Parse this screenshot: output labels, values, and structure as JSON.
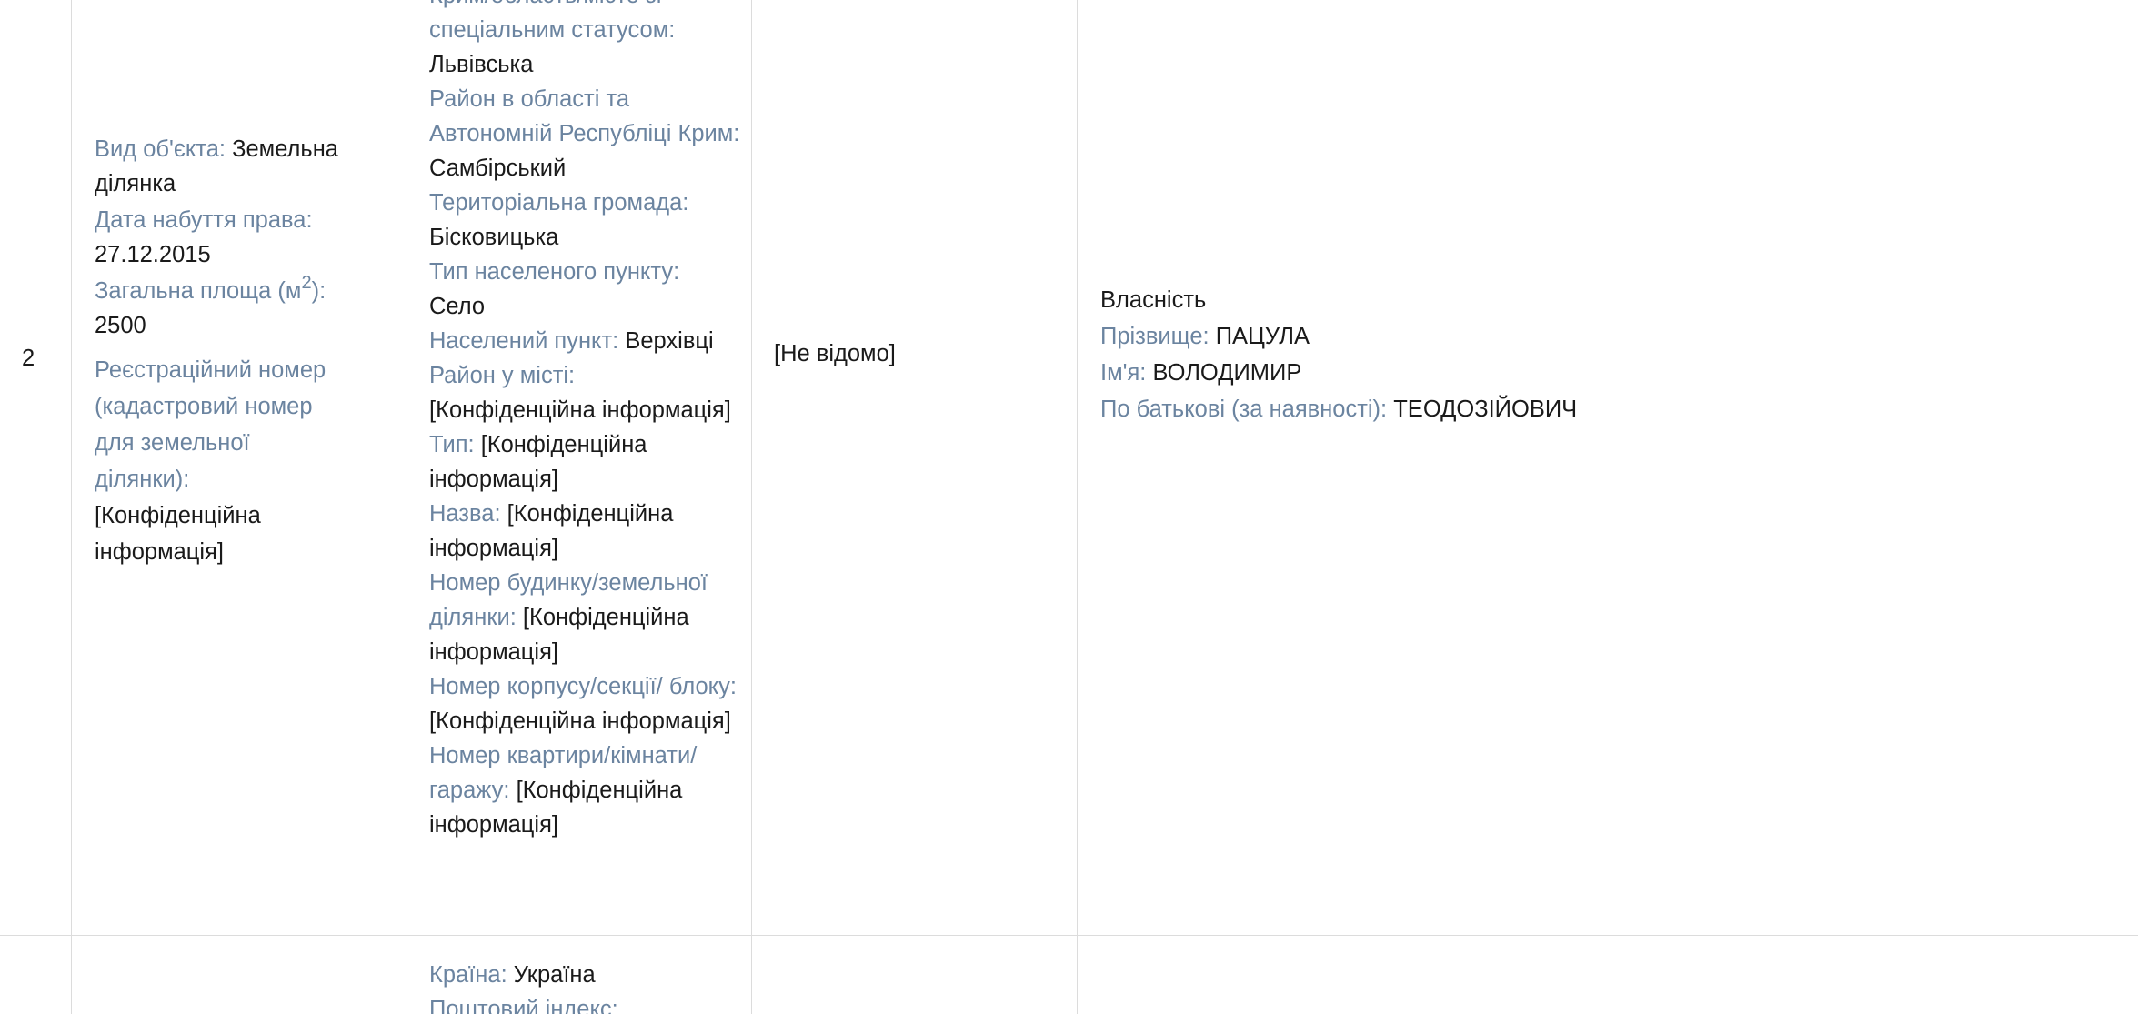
{
  "row2": {
    "number": "2",
    "object": {
      "type_label": "Вид об'єкта:",
      "type_value": "Земельна ділянка",
      "date_label": "Дата набуття права:",
      "date_value": "27.12.2015",
      "area_label_pre": "Загальна площа (м",
      "area_label_sup": "2",
      "area_label_post": "):",
      "area_value": "2500",
      "reg_label": "Реєстраційний номер (кадастровий номер для земельної ділянки):",
      "reg_value": "[Конфіденційна інформація]"
    },
    "address": {
      "region_label_cut": "Крим/область/місто зі",
      "region_label_2": "спеціальним статусом:",
      "region_value": "Львівська",
      "district_label": "Район в області та Автономній Республіці Крим:",
      "district_value": "Самбірський",
      "community_label": "Територіальна громада:",
      "community_value": "Бісковицька",
      "settlement_type_label": "Тип населеного пункту:",
      "settlement_type_value": "Село",
      "settlement_label": "Населений пункт:",
      "settlement_value": "Верхівці",
      "city_district_label": "Район у місті:",
      "city_district_value": "[Конфіденційна інформація]",
      "type_label": "Тип:",
      "type_value": "[Конфіденційна інформація]",
      "name_label": "Назва:",
      "name_value": "[Конфіденційна інформація]",
      "house_label": "Номер будинку/земельної ділянки:",
      "house_value": "[Конфіденційна інформація]",
      "building_label": "Номер корпусу/секції/ блоку:",
      "building_value": "[Конфіденційна інформація]",
      "apartment_label": "Номер квартири/кімнати/ гаражу:",
      "apartment_value": "[Конфіденційна інформація]"
    },
    "cost": "[Не відомо]",
    "right": {
      "kind": "Власність",
      "surname_label": "Прізвище:",
      "surname_value": "ПАЦУЛА",
      "name_label": "Ім'я:",
      "name_value": "ВОЛОДИМИР",
      "patronymic_label": "По батькові (за наявності):",
      "patronymic_value": "ТЕОДОЗІЙОВИЧ"
    }
  },
  "row3": {
    "country_label": "Країна:",
    "country_value": "Україна",
    "postal_label_cut": "Поштовий індекс:"
  }
}
